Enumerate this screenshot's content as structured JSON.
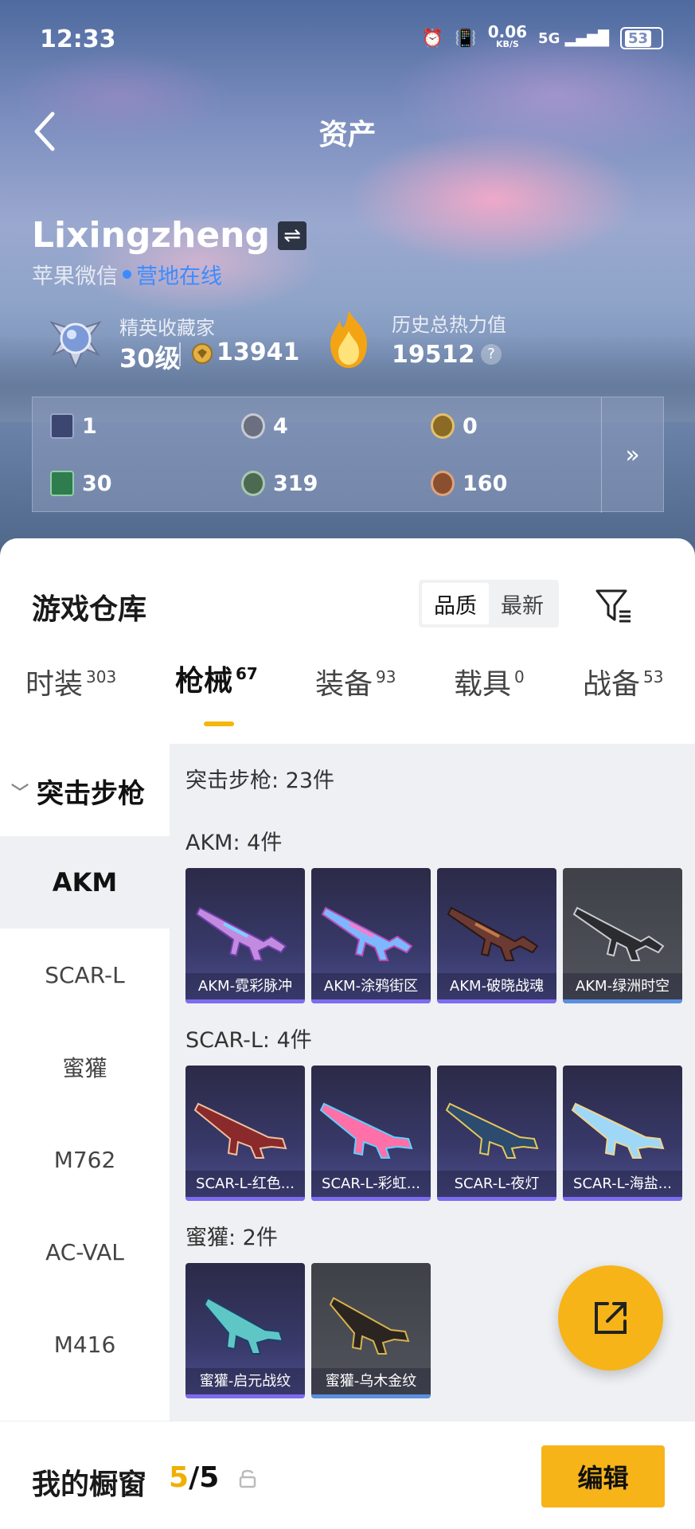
{
  "status_bar": {
    "time": "12:33",
    "speed": "0.06",
    "speed_unit": "KB/S",
    "network": "5G",
    "battery": "53"
  },
  "header": {
    "title": "资产"
  },
  "profile": {
    "username": "Lixingzheng",
    "platform": "苹果微信",
    "online_status": "营地在线",
    "rank_label": "精英收藏家",
    "rank_level": "30级",
    "coins": "13941",
    "heat_label": "历史总热力值",
    "heat_value": "19512",
    "help": "?"
  },
  "items_panel": {
    "row1": [
      {
        "icon": "card-icon",
        "count": "1",
        "color": "#3c4670"
      },
      {
        "icon": "silver-medal-icon",
        "count": "4",
        "color": "#6b7080"
      },
      {
        "icon": "gold-medal-icon",
        "count": "0",
        "color": "#8a6a24"
      }
    ],
    "row2": [
      {
        "icon": "green-card-icon",
        "count": "30",
        "color": "#2f7d4f"
      },
      {
        "icon": "green-orb-icon",
        "count": "319",
        "color": "#4c6a52"
      },
      {
        "icon": "bronze-orb-icon",
        "count": "160",
        "color": "#8a4f2e"
      }
    ],
    "more": "»"
  },
  "warehouse": {
    "title": "游戏仓库",
    "sort_quality": "品质",
    "sort_latest": "最新"
  },
  "tabs": [
    {
      "label": "时装",
      "count": "303"
    },
    {
      "label": "枪械",
      "count": "67"
    },
    {
      "label": "装备",
      "count": "93"
    },
    {
      "label": "载具",
      "count": "0"
    },
    {
      "label": "战备",
      "count": "53"
    }
  ],
  "left_nav": {
    "category": "突击步枪",
    "items": [
      "AKM",
      "SCAR-L",
      "蜜獾",
      "M762",
      "AC-VAL",
      "M416"
    ]
  },
  "grid": {
    "category_title": "突击步枪: 23件",
    "sections": [
      {
        "title": "AKM: 4件",
        "cards": [
          "AKM-霓彩脉冲",
          "AKM-涂鸦街区",
          "AKM-破晓战魂",
          "AKM-绿洲时空"
        ]
      },
      {
        "title": "SCAR-L: 4件",
        "cards": [
          "SCAR-L-红色...",
          "SCAR-L-彩虹...",
          "SCAR-L-夜灯",
          "SCAR-L-海盐..."
        ]
      },
      {
        "title": "蜜獾: 2件",
        "cards": [
          "蜜獾-启元战纹",
          "蜜獾-乌木金纹"
        ]
      }
    ]
  },
  "bottom_bar": {
    "showcase_label": "我的橱窗",
    "showcase_current": "5",
    "showcase_sep": "/",
    "showcase_total": "5",
    "edit_label": "编辑"
  },
  "colors": {
    "accent": "#f6b419",
    "online": "#3b8cff",
    "card_bar": "#7d6cf0"
  }
}
